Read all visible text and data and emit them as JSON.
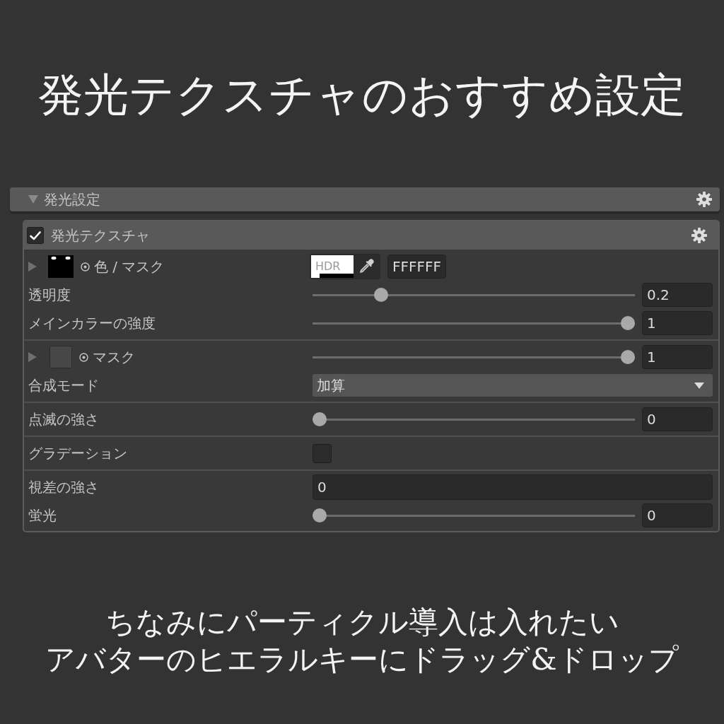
{
  "title": "発光テクスチャのおすすめ設定",
  "section": {
    "label": "発光設定",
    "expanded": true
  },
  "panel": {
    "label": "発光テクスチャ",
    "checked": true,
    "groups": [
      [
        {
          "kind": "texture_color",
          "label": "色 / マスク",
          "expanded": false,
          "assigned": true,
          "hdr": "HDR",
          "hex": "FFFFFF"
        },
        {
          "kind": "slider",
          "label": "透明度",
          "level": 0.2,
          "value": "0.2"
        },
        {
          "kind": "slider",
          "label": "メインカラーの強度",
          "level": 1,
          "value": "1"
        }
      ],
      [
        {
          "kind": "texture_slider",
          "label": "マスク",
          "expanded": false,
          "assigned": false,
          "level": 1,
          "value": "1"
        },
        {
          "kind": "dropdown",
          "label": "合成モード",
          "value": "加算"
        }
      ],
      [
        {
          "kind": "slider",
          "label": "点滅の強さ",
          "level": 0,
          "value": "0"
        }
      ],
      [
        {
          "kind": "checkbox",
          "label": "グラデーション",
          "checked": false
        }
      ],
      [
        {
          "kind": "number",
          "label": "視差の強さ",
          "value": "0"
        },
        {
          "kind": "slider",
          "label": "蛍光",
          "level": 0,
          "value": "0"
        }
      ]
    ]
  },
  "caption": [
    "ちなみにパーティクル導入は入れたい",
    "アバターのヒエラルキーにドラッグ&ドロップ"
  ]
}
